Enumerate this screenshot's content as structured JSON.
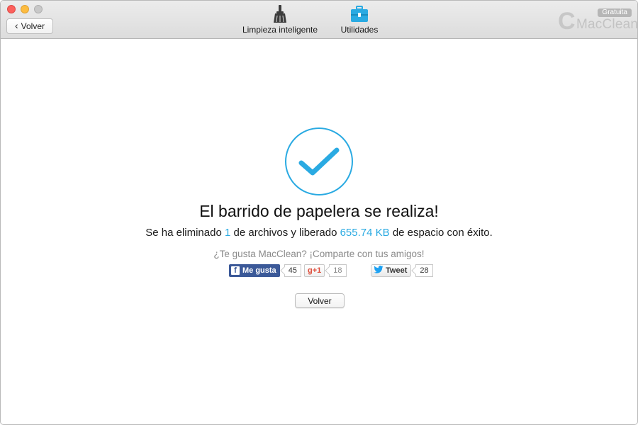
{
  "titlebar": {
    "back_label": "Volver",
    "tabs": [
      {
        "label": "Limpieza inteligente",
        "icon": "broom-icon"
      },
      {
        "label": "Utilidades",
        "icon": "toolbox-icon"
      }
    ],
    "brand": {
      "badge": "Gratuita",
      "initial": "C",
      "name": "MacClean"
    }
  },
  "main": {
    "headline": "El barrido de papelera se realiza!",
    "sub_prefix": "Se ha eliminado",
    "files_count": "1",
    "sub_middle": "de archivos y liberado",
    "freed_size": "655.74 KB",
    "sub_suffix": "de espacio con éxito.",
    "share_prompt": "¿Te gusta MacClean? ¡Comparte con tus amigos!",
    "social": {
      "facebook_label": "Me gusta",
      "facebook_count": "45",
      "gplus_label": "+1",
      "gplus_count": "18",
      "twitter_label": "Tweet",
      "twitter_count": "28"
    },
    "volver_label": "Volver"
  },
  "colors": {
    "accent": "#2aaae2",
    "facebook": "#3b5998",
    "gplus": "#dd4b39",
    "twitter": "#1da1f2"
  }
}
